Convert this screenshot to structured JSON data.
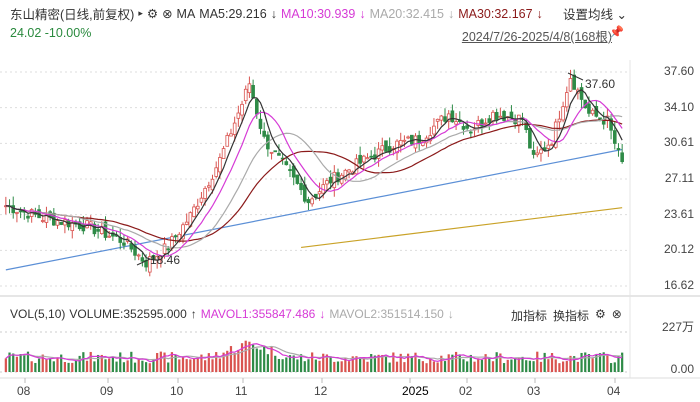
{
  "header": {
    "stock": "东山精密(日线,前复权)",
    "arrow": "▸",
    "ma_label": "MA",
    "ma5": "MA5:29.216",
    "ma10": "MA10:30.939",
    "ma20": "MA20:32.415",
    "ma30": "MA30:32.167",
    "down": "↓",
    "settings": "设置均线 ⌄",
    "price_change": "24.02 -10.00%",
    "range": "2024/7/26-2025/4/8(168根)"
  },
  "colors": {
    "up": "#d9534f",
    "down": "#2e8b47",
    "ma5": "#333333",
    "ma10": "#d63ad6",
    "ma20": "#aaaaaa",
    "ma30": "#8b1a1a",
    "ma60": "#5b8fd6",
    "ma120": "#c9a227"
  },
  "volume_panel": {
    "name": "VOL(5,10)",
    "volume": "VOLUME:352595.000",
    "up": "↑",
    "mavol1": "MAVOL1:355847.486",
    "mavol2": "MAVOL2:351514.150",
    "down": "↓",
    "add_indicator": "加指标",
    "switch_indicator": "换指标",
    "ymax": "227万",
    "ymin": "0.00"
  },
  "chart_data": {
    "type": "candlestick",
    "bars": 168,
    "ylim": [
      16.62,
      37.6
    ],
    "yticks": [
      "37.60",
      "34.10",
      "30.61",
      "27.11",
      "23.61",
      "20.12",
      "16.62"
    ],
    "xticks": [
      "08",
      "09",
      "10",
      "11",
      "12",
      "2025",
      "02",
      "03",
      "04"
    ],
    "annotations": {
      "high": "37.60",
      "low": "18.46"
    },
    "close_keypoints": [
      [
        0,
        24.5
      ],
      [
        10,
        23.3
      ],
      [
        22,
        22.5
      ],
      [
        32,
        21
      ],
      [
        38,
        18.9
      ],
      [
        44,
        20.5
      ],
      [
        50,
        23.5
      ],
      [
        58,
        29
      ],
      [
        64,
        34.5
      ],
      [
        66,
        36.5
      ],
      [
        70,
        31
      ],
      [
        76,
        28
      ],
      [
        82,
        25
      ],
      [
        88,
        27
      ],
      [
        95,
        28.5
      ],
      [
        105,
        30.5
      ],
      [
        112,
        31
      ],
      [
        120,
        33.5
      ],
      [
        126,
        32
      ],
      [
        132,
        33.5
      ],
      [
        140,
        33
      ],
      [
        143,
        29
      ],
      [
        148,
        31
      ],
      [
        153,
        37.2
      ],
      [
        158,
        33.5
      ],
      [
        163,
        32.8
      ],
      [
        166,
        29.5
      ],
      [
        167,
        28.6
      ]
    ],
    "ma60_line": [
      [
        0,
        18.2
      ],
      [
        167,
        30
      ]
    ],
    "ma120_line": [
      [
        80,
        20.4
      ],
      [
        167,
        24.3
      ]
    ]
  }
}
